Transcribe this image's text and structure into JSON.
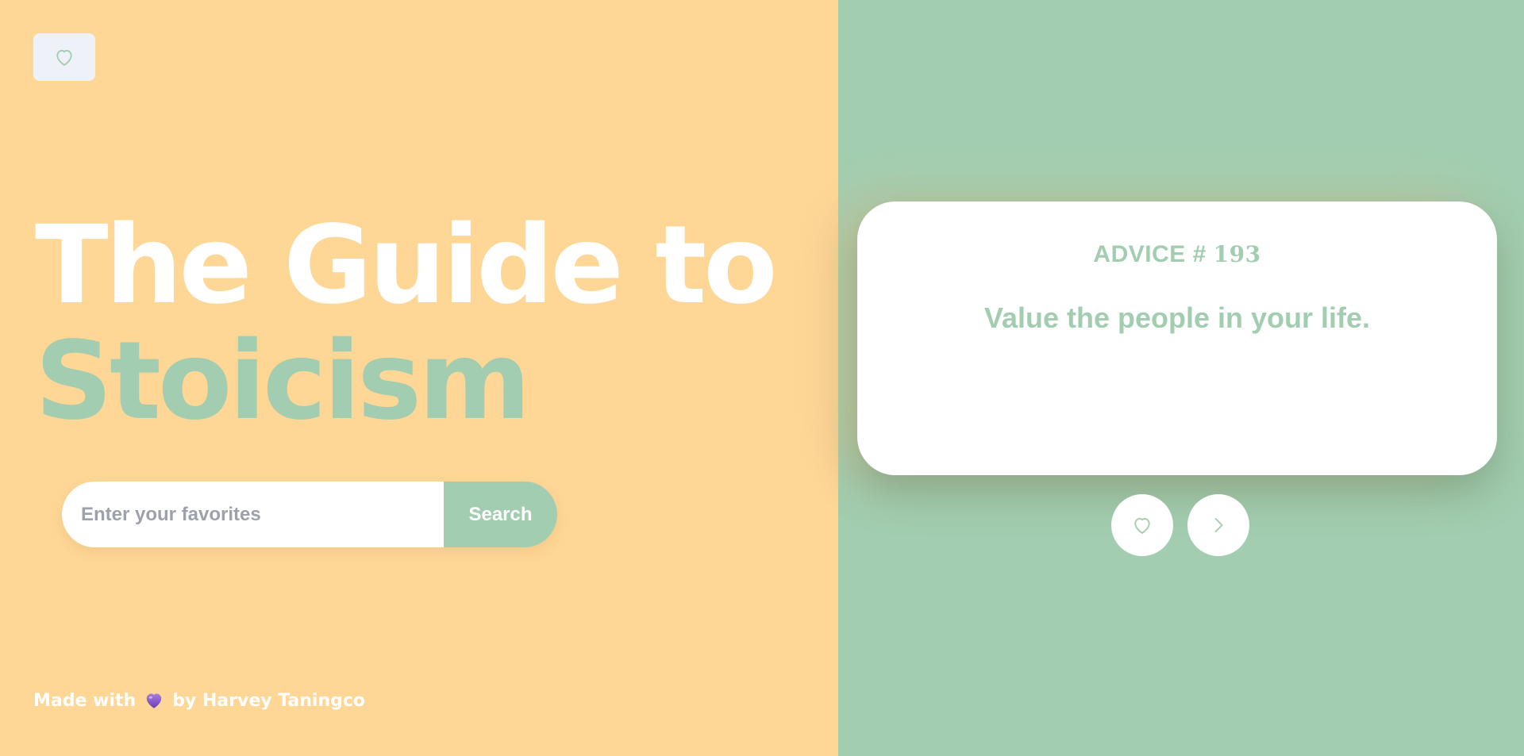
{
  "header": {
    "favorites_icon": "heart-outline-icon"
  },
  "hero": {
    "title_line1": "The Guide to",
    "title_line2": "Stoicism"
  },
  "search": {
    "placeholder": "Enter your favorites",
    "button_label": "Search"
  },
  "footer": {
    "prefix": "Made with",
    "heart_icon": "purple-heart-icon",
    "suffix": "by Harvey Taningco"
  },
  "advice": {
    "label": "ADVICE #",
    "number": "193",
    "text": "Value the people in your life."
  },
  "actions": {
    "like_icon": "heart-outline-icon",
    "next_icon": "chevron-right-icon"
  },
  "colors": {
    "left_bg": "#FED797",
    "right_bg": "#A3CDB0",
    "accent": "#A3CDB0",
    "white": "#FFFFFF"
  }
}
